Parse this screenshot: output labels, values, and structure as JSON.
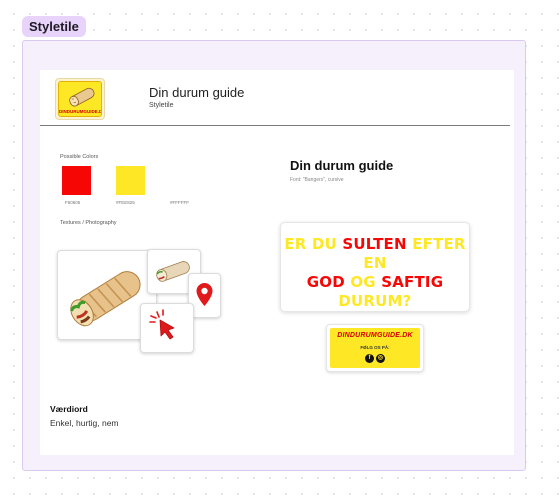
{
  "section_tag": "Styletile",
  "header": {
    "logo_text": "DINDURUMGUIDE.DK",
    "title": "Din durum guide",
    "subtitle": "Styletile"
  },
  "colors": {
    "label": "Possible Colors",
    "swatches": [
      {
        "hex": "#F60605",
        "label": "F60605"
      },
      {
        "hex": "#FEE825",
        "label": "#FEE825"
      },
      {
        "hex": "#FFFFFF",
        "label": "#FFFFFF"
      }
    ]
  },
  "textures": {
    "label": "Textures / Photography",
    "icons": [
      "durum-wrap-icon",
      "small-wrap-icon",
      "location-pin-icon",
      "cursor-click-icon"
    ]
  },
  "font": {
    "title": "Din durum guide",
    "subtitle": "Font: \"Bangers\", cursive"
  },
  "promo": {
    "line1a": "ER DU ",
    "line1b": "SULTEN",
    "line1c": " EFTER EN",
    "line2a": "GOD",
    "line2b": " OG ",
    "line2c": "SAFTIG",
    "line3": "DURUM?"
  },
  "social_card": {
    "title": "DINDURUMGUIDE.DK",
    "follow": "FØLG OS PÅ:",
    "facebook_glyph": "f",
    "instagram_glyph": "◎"
  },
  "values": {
    "title": "Værdiord",
    "text": "Enkel, hurtig, nem"
  },
  "accent_colors": {
    "red": "#F60605",
    "yellow": "#FEE825",
    "frame": "#E8D4FB"
  }
}
